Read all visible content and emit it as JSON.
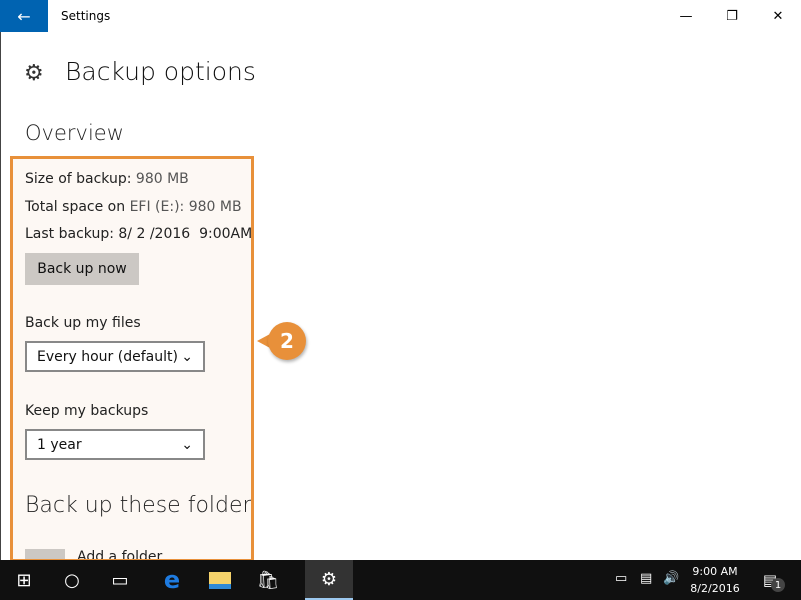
{
  "window": {
    "title": "Settings",
    "back_icon": "arrow-left-icon",
    "minimize_icon": "minimize-icon",
    "restore_icon": "restore-icon",
    "close_icon": "close-icon"
  },
  "page": {
    "icon": "gear-icon",
    "title": "Backup options"
  },
  "overview": {
    "heading": "Overview",
    "size_label": "Size of backup:",
    "size_value": "980 MB",
    "space_label": "Total space on",
    "space_drive": "EFI (E:):",
    "space_value": "980 MB",
    "last_label": "Last backup:",
    "last_value": "8/ 2 /2016  9:00AM",
    "back_up_now": "Back up now"
  },
  "backup_files": {
    "label": "Back up my files",
    "selected": "Every hour (default)"
  },
  "keep_backups": {
    "label": "Keep my backups",
    "selected": "1 year"
  },
  "folders": {
    "heading": "Back up these folders",
    "add_label": "Add a folder"
  },
  "callout": {
    "number": "2",
    "color": "#e8903a"
  },
  "taskbar": {
    "items": [
      "start-icon",
      "cortana-icon",
      "task-view-icon",
      "edge-icon",
      "file-explorer-icon",
      "store-icon",
      "settings-icon"
    ],
    "time": "9:00 AM",
    "date": "8/2/2016",
    "notifications": "1"
  },
  "colors": {
    "accent": "#0063b1",
    "highlight": "#e8903a"
  }
}
